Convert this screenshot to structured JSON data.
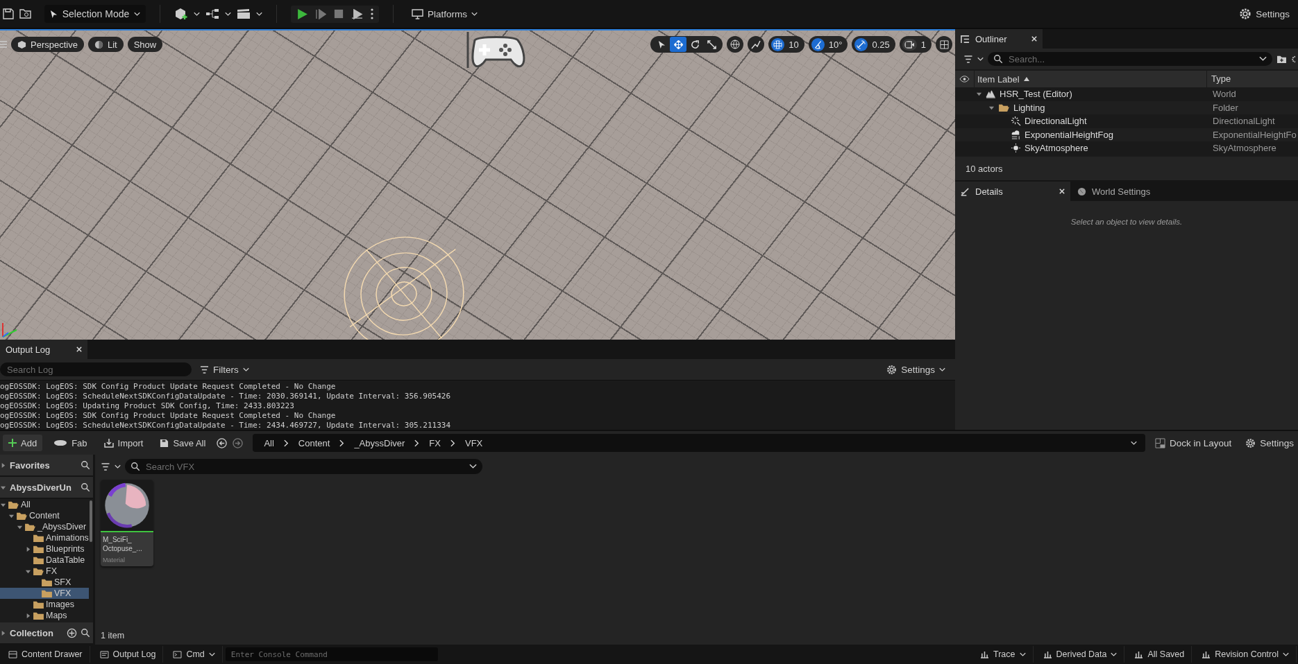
{
  "toolbar": {
    "mode": "Selection Mode",
    "platforms": "Platforms",
    "settings": "Settings"
  },
  "viewport": {
    "view_buttons": [
      "Perspective",
      "Lit",
      "Show"
    ],
    "transform_tools": [
      {
        "kind": "select",
        "selected": false
      },
      {
        "kind": "translate",
        "selected": true
      },
      {
        "kind": "rotate",
        "selected": false
      },
      {
        "kind": "scale",
        "selected": false
      }
    ],
    "snaps": [
      {
        "kind": "grid",
        "on": true,
        "value": "10"
      },
      {
        "kind": "angle",
        "on": true,
        "value": "10°"
      },
      {
        "kind": "scale",
        "on": true,
        "value": "0.25"
      },
      {
        "kind": "camera",
        "on": false,
        "value": "1"
      }
    ]
  },
  "outliner": {
    "title": "Outliner",
    "search_placeholder": "Search...",
    "columns": [
      "Item Label",
      "Type"
    ],
    "items": [
      {
        "kind": "world",
        "label": "HSR_Test (Editor)",
        "type": "World",
        "expanded": true,
        "children": [
          {
            "kind": "folder",
            "label": "Lighting",
            "type": "Folder",
            "expanded": true,
            "children": [
              {
                "kind": "light",
                "label": "DirectionalLight",
                "type": "DirectionalLight"
              },
              {
                "kind": "fog",
                "label": "ExponentialHeightFog",
                "type": "ExponentialHeightFo"
              },
              {
                "kind": "sky",
                "label": "SkyAtmosphere",
                "type": "SkyAtmosphere"
              }
            ]
          }
        ]
      }
    ],
    "status": "10 actors"
  },
  "details": {
    "tabs": [
      {
        "label": "Details",
        "selected": true
      },
      {
        "label": "World Settings",
        "selected": false
      }
    ],
    "message": "Select an object to view details."
  },
  "output_log": {
    "title": "Output Log",
    "search_placeholder": "Search Log",
    "filters": "Filters",
    "settings": "Settings",
    "lines": [
      "ogEOSSDK: LogEOS: SDK Config Product Update Request Completed - No Change",
      "ogEOSSDK: LogEOS: ScheduleNextSDKConfigDataUpdate - Time: 2030.369141, Update Interval: 356.905426",
      "ogEOSSDK: LogEOS: Updating Product SDK Config, Time: 2433.803223",
      "ogEOSSDK: LogEOS: SDK Config Product Update Request Completed - No Change",
      "ogEOSSDK: LogEOS: ScheduleNextSDKConfigDataUpdate - Time: 2434.469727, Update Interval: 305.211334"
    ]
  },
  "content_browser": {
    "actions": [
      "Add",
      "Fab",
      "Import",
      "Save All"
    ],
    "breadcrumbs": [
      "All",
      "Content",
      "_AbyssDiver",
      "FX",
      "VFX"
    ],
    "dock": "Dock in Layout",
    "settings": "Settings",
    "sections": [
      {
        "label": "Favorites",
        "expanded": false
      },
      {
        "label": "AbyssDiverUn",
        "expanded": true
      },
      {
        "label": "Collection",
        "expanded": false
      }
    ],
    "folders": [
      {
        "label": "All",
        "expanded": true,
        "selected": false,
        "children": [
          {
            "label": "Content",
            "expanded": true,
            "selected": false,
            "children": [
              {
                "label": "_AbyssDiver",
                "expanded": true,
                "selected": false,
                "children": [
                  {
                    "label": "Animations",
                    "expanded": false,
                    "selected": false
                  },
                  {
                    "label": "Blueprints",
                    "expanded": false,
                    "selected": false,
                    "expandable": true
                  },
                  {
                    "label": "DataTable",
                    "expanded": false,
                    "selected": false
                  },
                  {
                    "label": "FX",
                    "expanded": true,
                    "selected": false,
                    "children": [
                      {
                        "label": "SFX",
                        "expanded": false,
                        "selected": false
                      },
                      {
                        "label": "VFX",
                        "expanded": false,
                        "selected": true
                      }
                    ]
                  },
                  {
                    "label": "Images",
                    "expanded": false,
                    "selected": false
                  },
                  {
                    "label": "Maps",
                    "expanded": false,
                    "selected": false,
                    "expandable": true
                  }
                ]
              }
            ]
          }
        ]
      }
    ],
    "search_placeholder": "Search VFX",
    "assets": [
      {
        "name": "M_SciFi_ Octopuse_...",
        "type": "Material"
      }
    ],
    "count": "1 item"
  },
  "status_bar": {
    "items": [
      "Content Drawer",
      "Output Log",
      "Cmd"
    ],
    "console_placeholder": "Enter Console Command",
    "right": [
      "Trace",
      "Derived Data",
      "All Saved",
      "Revision Control"
    ]
  }
}
